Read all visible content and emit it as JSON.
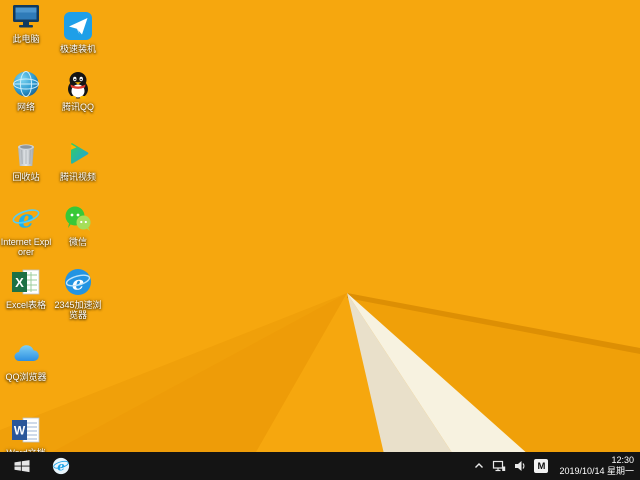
{
  "desktop": {
    "icons": [
      {
        "label": "此电脑"
      },
      {
        "label": "极速装机"
      },
      {
        "label": "网络"
      },
      {
        "label": "腾讯QQ"
      },
      {
        "label": "回收站"
      },
      {
        "label": "腾讯视频"
      },
      {
        "label": "Internet Explorer"
      },
      {
        "label": "微信"
      },
      {
        "label": "Excel表格"
      },
      {
        "label": "2345加速浏览器"
      },
      {
        "label": "QQ浏览器"
      },
      {
        "label": "Word文档"
      }
    ],
    "wallpaper_colors": {
      "base": "#F6A70E",
      "shade_left": "#F0A00A",
      "shade_left_dark": "#EE9C08",
      "shade_right": "#F0A009",
      "fold_edge": "#DD8F04",
      "cream_dark": "#E9E0CA",
      "cream_light": "#F7F2E0"
    }
  },
  "taskbar": {
    "background": "#141414",
    "tray": {
      "time": "12:30",
      "date": "2019/10/14 星期一",
      "ime_label": "M"
    }
  }
}
